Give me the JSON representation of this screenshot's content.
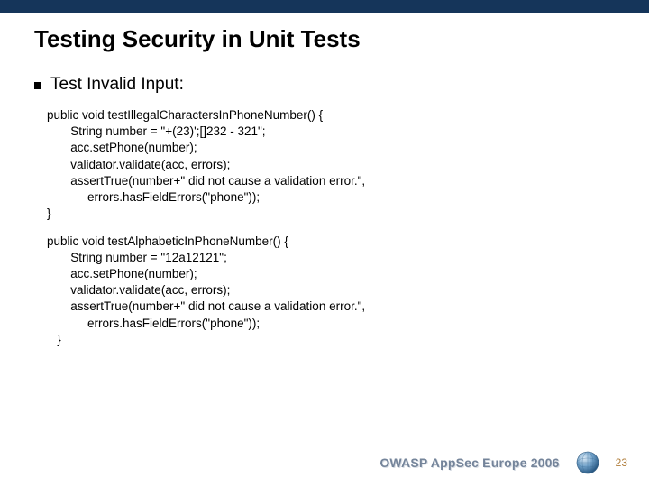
{
  "topbar_color": "#15355a",
  "title": "Testing Security in Unit Tests",
  "bullet": "Test Invalid Input:",
  "code1": "public void testIllegalCharactersInPhoneNumber() {\n       String number = \"+(23)';[]232 - 321\";\n       acc.setPhone(number);\n       validator.validate(acc, errors);\n       assertTrue(number+\" did not cause a validation error.\",\n            errors.hasFieldErrors(\"phone\"));\n}",
  "code2": "public void testAlphabeticInPhoneNumber() {\n       String number = \"12a12121\";\n       acc.setPhone(number);\n       validator.validate(acc, errors);\n       assertTrue(number+\" did not cause a validation error.\",\n            errors.hasFieldErrors(\"phone\"));\n   }",
  "footer": {
    "text": "OWASP AppSec Europe 2006",
    "page": "23"
  },
  "icons": {
    "globe": "globe-icon"
  }
}
